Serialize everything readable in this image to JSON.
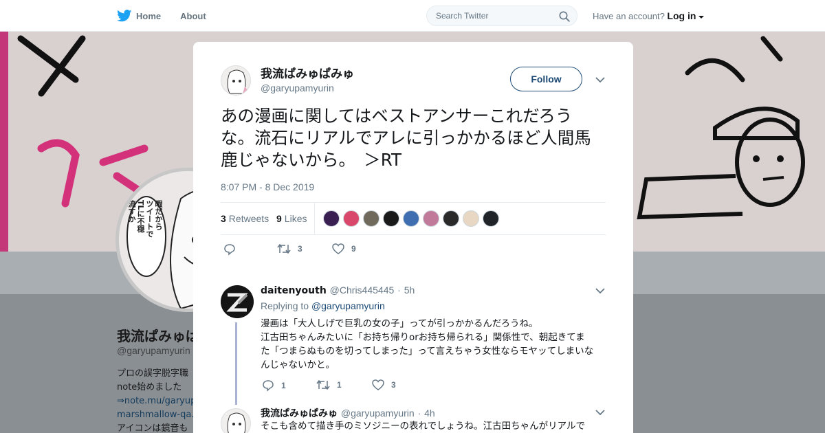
{
  "nav": {
    "home": "Home",
    "about": "About",
    "search_placeholder": "Search Twitter",
    "have_account": "Have an account?",
    "login": "Log in"
  },
  "profile": {
    "name": "我流ぱみゅぱ",
    "handle": "@garyupamyurin",
    "bio": [
      "プロの誤字脱字職",
      "note始めました",
      "⇒note.mu/garyup",
      "marshmallow-qa.c",
      "アイコンは鏡音も"
    ],
    "avatar_speech": "暇だから\nツイートで\nTLに不穏\n流すか"
  },
  "tweet": {
    "author_name": "我流ぱみゅぱみゅ",
    "author_handle": "@garyupamyurin",
    "follow_label": "Follow",
    "text": "あの漫画に関してはベストアンサーこれだろうな。流石にリアルでアレに引っかかるほど人間馬鹿じゃないから。　＞RT",
    "timestamp": "8:07 PM - 8 Dec 2019",
    "retweets_count": "3",
    "retweets_label": "Retweets",
    "likes_count": "9",
    "likes_label": "Likes",
    "action_retweets": "3",
    "action_likes": "9",
    "liker_avatar_colors": [
      "#3a1f52",
      "#d9486a",
      "#6f6a5c",
      "#1a1a1a",
      "#3f6fb0",
      "#c27a9a",
      "#2a2a2a",
      "#e8d7c2",
      "#202428"
    ]
  },
  "replies": [
    {
      "name": "daitenyouth",
      "handle": "@Chris445445",
      "time": "5h",
      "replying_to_label": "Replying to",
      "replying_to": "@garyupamyurin",
      "text": [
        "漫画は「大人しげで巨乳の女の子」ってが引っかかるんだろうね。",
        "江古田ちゃんみたいに「お持ち帰りorお持ち帰られる」関係性で、朝起きてま",
        "た「つまらぬものを切ってしまった」って言えちゃう女性ならモヤッてしまいな",
        "んじゃないかと。"
      ],
      "reply_count": "1",
      "retweet_count": "1",
      "like_count": "3"
    },
    {
      "name": "我流ぱみゅぱみゅ",
      "handle": "@garyupamyurin",
      "time": "4h",
      "text": [
        "そこも含めて描き手のミソジニーの表れでしょうね。江古田ちゃんがリアルで"
      ]
    }
  ]
}
